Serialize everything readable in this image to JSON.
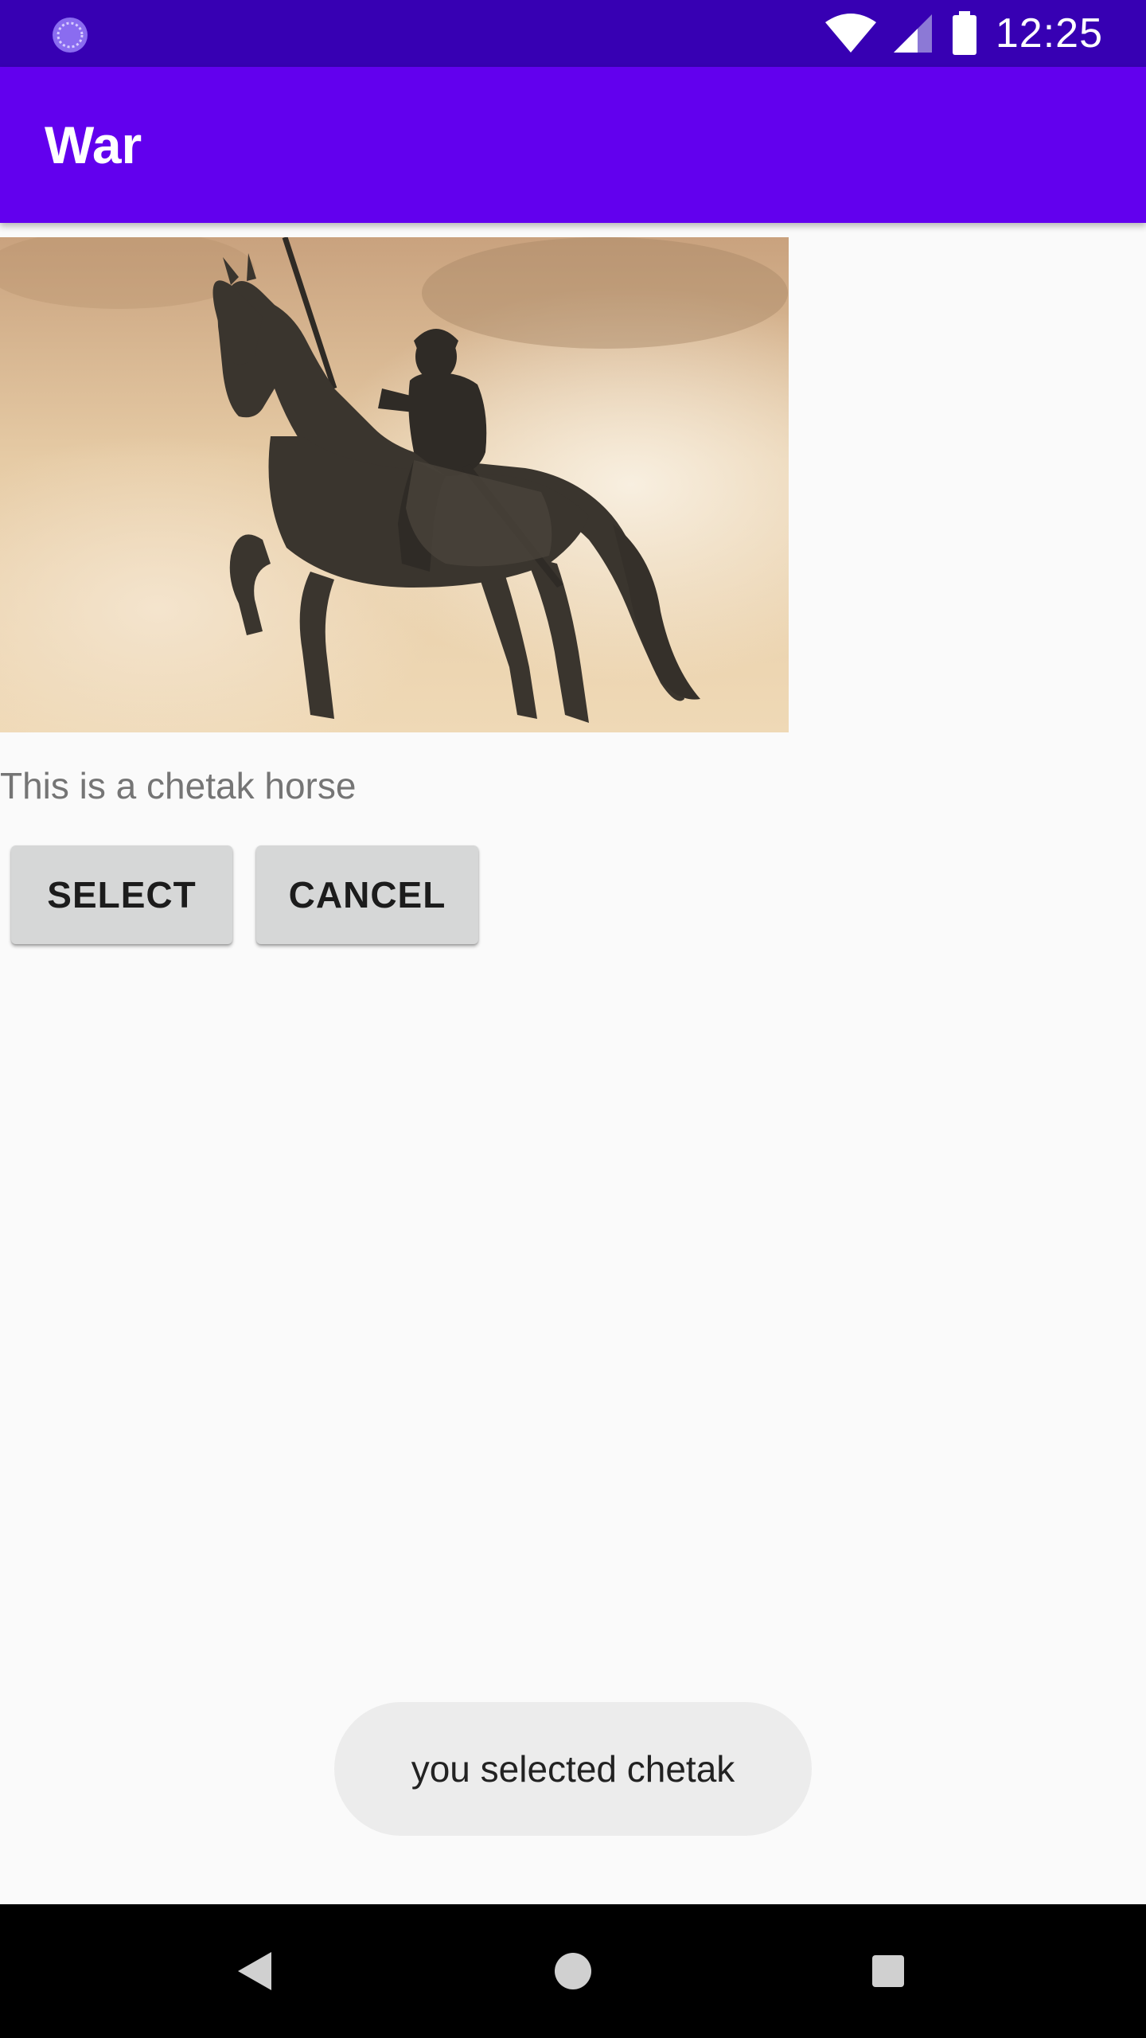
{
  "status_bar": {
    "time": "12:25",
    "icons": [
      "app-notification-icon",
      "wifi-icon",
      "cellular-signal-icon",
      "battery-icon"
    ]
  },
  "app_bar": {
    "title": "War"
  },
  "content": {
    "image_subject": "horse-statue-image",
    "caption": "This is a chetak horse",
    "buttons": {
      "select_label": "SELECT",
      "cancel_label": "CANCEL"
    }
  },
  "toast": {
    "message": "you selected chetak"
  },
  "nav_bar": {
    "icons": [
      "back-icon",
      "home-icon",
      "recents-icon"
    ]
  },
  "colors": {
    "status_bar": "#3700b3",
    "app_bar": "#6200ee",
    "background": "#fafafa",
    "button": "#d6d7d7",
    "toast": "#ececec",
    "nav_bar": "#000000"
  }
}
